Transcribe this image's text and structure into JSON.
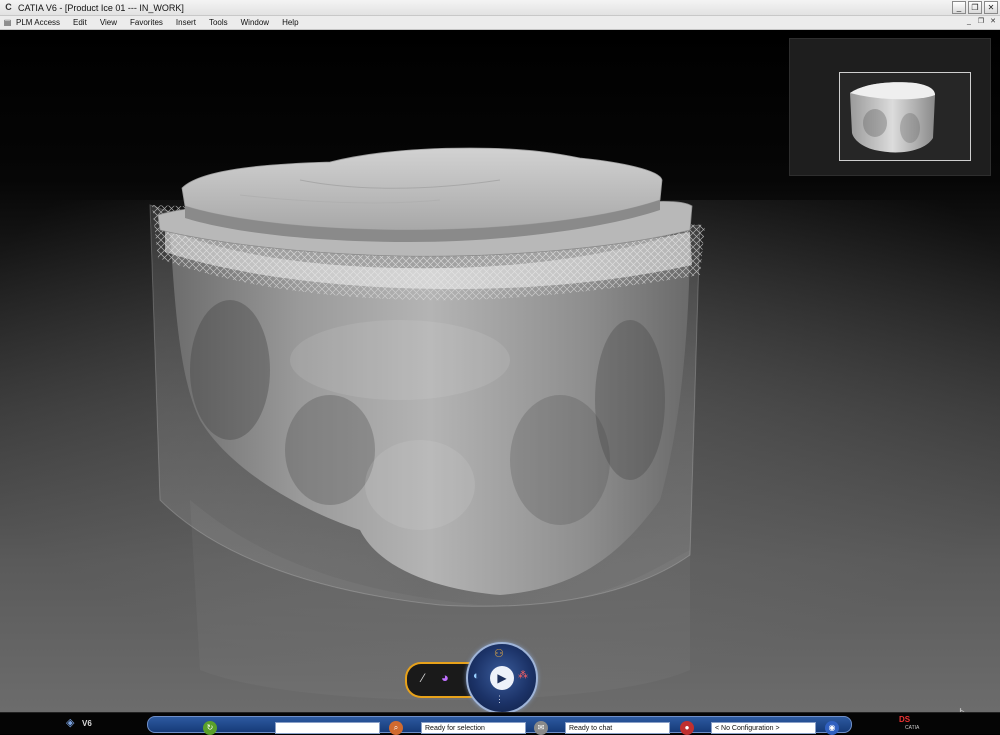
{
  "window": {
    "title": "CATIA V6 - [Product Ice 01 --- IN_WORK]",
    "app_icon": "catia-c-icon",
    "controls": [
      "minimize",
      "restore",
      "close"
    ]
  },
  "menubar": {
    "items": [
      "PLM Access",
      "Edit",
      "View",
      "Favorites",
      "Insert",
      "Tools",
      "Window",
      "Help"
    ]
  },
  "compass": {
    "center_icon": "play-icon",
    "top_icon": "users-icon",
    "left_icon": "globe-icon",
    "right_icon": "network-icon"
  },
  "statusbar": {
    "brand_label": "V6",
    "selection_field": "",
    "selection_status": "Ready for selection",
    "chat_status": "Ready to chat",
    "configuration": "< No Configuration >",
    "ds_logo": "DS",
    "ds_logo_sub": "CATIA"
  },
  "colors": {
    "accent_orange": "#e8a21a",
    "status_blue": "#1f4a90"
  }
}
